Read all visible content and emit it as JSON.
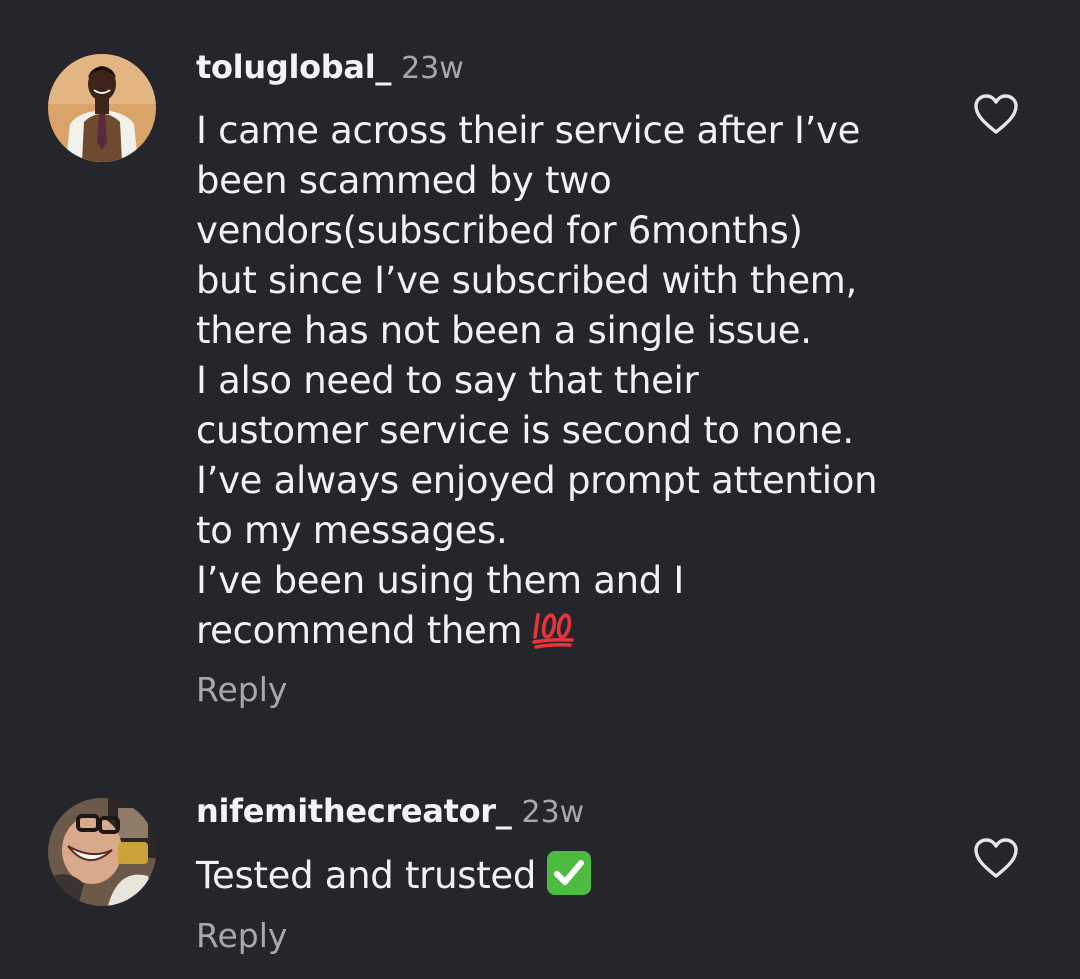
{
  "comments": [
    {
      "username": "toluglobal_",
      "time": "23w",
      "lines": [
        "I came across their service after I’ve",
        "been scammed by two",
        "vendors(subscribed for 6months)",
        "but since I’ve subscribed with them,",
        "there has not been a single issue.",
        "I also need to say that their",
        "customer service is second to none.",
        "I’ve always enjoyed prompt attention",
        "to my messages.",
        "I’ve been using them and I",
        "recommend them"
      ],
      "emoji": "hundred-points-icon",
      "reply_label": "Reply",
      "like_icon": "heart-outline-icon"
    },
    {
      "username": "nifemithecreator_",
      "time": "23w",
      "lines": [
        "Tested and trusted"
      ],
      "emoji": "check-mark-button-icon",
      "reply_label": "Reply",
      "like_icon": "heart-outline-icon"
    }
  ],
  "colors": {
    "background": "#25262b",
    "text": "#f2f2f2",
    "muted": "#a6a8ad",
    "emoji_red": "#e8343a",
    "check_green": "#4cbb3f"
  }
}
